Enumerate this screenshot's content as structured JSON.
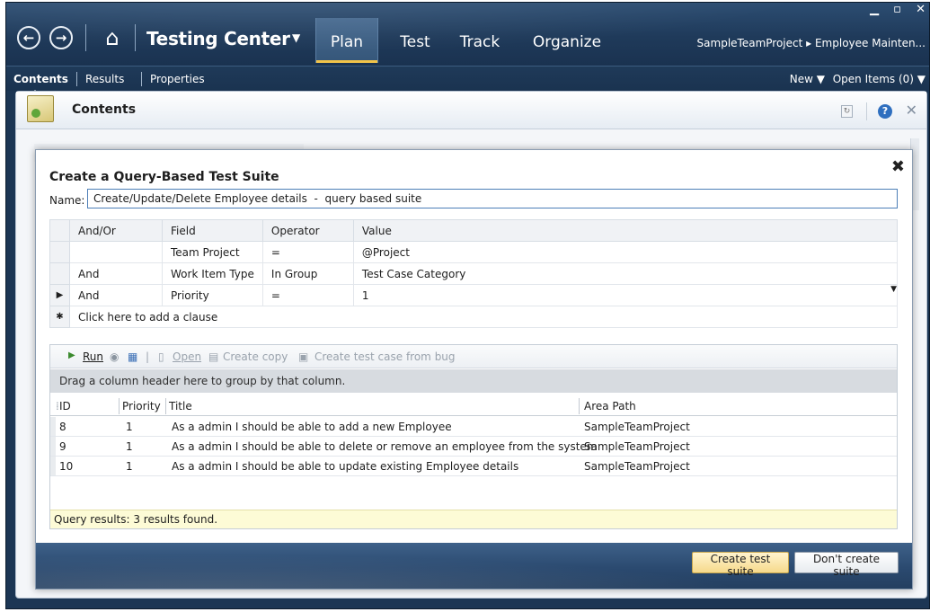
{
  "titlebar": {
    "back_icon": "back-arrow-icon",
    "forward_icon": "forward-arrow-icon",
    "home_icon": "home-icon",
    "app_title": "Testing Center",
    "dropdown_glyph": "▼",
    "tabs": [
      {
        "label": "Plan",
        "selected": true
      },
      {
        "label": "Test",
        "selected": false
      },
      {
        "label": "Track",
        "selected": false
      },
      {
        "label": "Organize",
        "selected": false
      }
    ],
    "breadcrumb": "SampleTeamProject ▸ Employee Mainten...",
    "window_controls": "▁ ▫ ✕"
  },
  "subnav": {
    "contents": "Contents",
    "results": "Results",
    "properties": "Properties",
    "new": "New ▼",
    "open_items": "Open Items (0) ▼"
  },
  "page": {
    "title": "Contents"
  },
  "dialog": {
    "title": "Create a Query-Based Test Suite",
    "close_glyph": "✖",
    "name_label": "Name:",
    "name_value": "Create/Update/Delete Employee details  -  query based suite",
    "clause_headers": [
      "And/Or",
      "Field",
      "Operator",
      "Value"
    ],
    "clauses": [
      {
        "andor": "",
        "field": "Team Project",
        "operator": "=",
        "value": "@Project"
      },
      {
        "andor": "And",
        "field": "Work Item Type",
        "operator": "In Group",
        "value": "Test Case Category"
      },
      {
        "andor": "And",
        "field": "Priority",
        "operator": "=",
        "value": "1"
      }
    ],
    "add_clause": "Click here to add a clause",
    "toolbar": {
      "run": "Run",
      "open": "Open",
      "create_copy": "Create copy",
      "create_from_bug": "Create test case from bug"
    },
    "group_hint": "Drag a column header here to group by that column.",
    "result_headers": [
      "ID",
      "Priority",
      "Title",
      "Area Path"
    ],
    "results": [
      {
        "id": "8",
        "priority": "1",
        "title": "As a admin I should be able to add a new Employee",
        "area": "SampleTeamProject"
      },
      {
        "id": "9",
        "priority": "1",
        "title": "As a admin I should be able to delete or remove an employee from the system",
        "area": "SampleTeamProject"
      },
      {
        "id": "10",
        "priority": "1",
        "title": "As a admin I should be able to update existing Employee details",
        "area": "SampleTeamProject"
      }
    ],
    "status": "Query results: 3 results found.",
    "create_button": "Create test suite",
    "dont_create_button": "Don't create suite"
  },
  "colors": {
    "chrome": "#1f3a5a",
    "tab_highlight": "#f2c449",
    "primary_button": "#f6d98b",
    "status_bar": "#fdfbd6"
  }
}
